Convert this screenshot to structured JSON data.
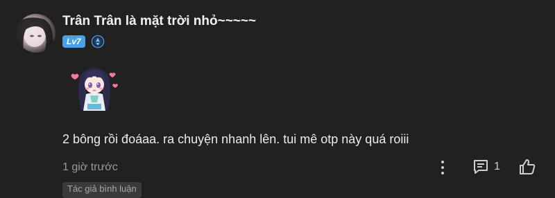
{
  "comment": {
    "username": "Trân Trân là mặt trời nhỏ~~~~~",
    "level_badge": "Lv7",
    "text": "2 bông rồi đoáaa. ra chuyện nhanh lên. tui mê otp này quá roiii",
    "timestamp": "1 giờ trước",
    "reply_count": "1",
    "author_tag": "Tác giả bình luận"
  },
  "colors": {
    "background": "#212121",
    "level_badge": "#4aa0e6",
    "rank_badge": "#3f8fe0",
    "muted_text": "#9a9a9a"
  },
  "icons": {
    "rank": "blue-rank-emblem-icon",
    "more": "more-vertical-icon",
    "reply": "comment-bubble-icon",
    "like": "thumbs-up-icon"
  }
}
